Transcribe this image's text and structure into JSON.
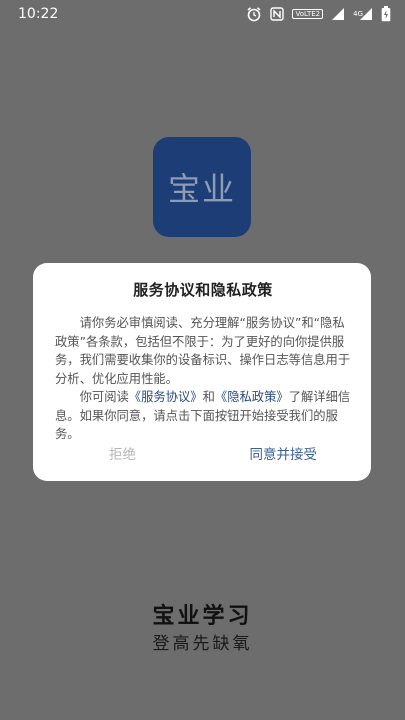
{
  "status_bar": {
    "time": "10:22",
    "volte": "VoLTE2",
    "network_label": "4G",
    "icons": [
      "alarm-icon",
      "nfc-icon",
      "volte-icon",
      "signal-icon",
      "battery-icon"
    ]
  },
  "app_icon": {
    "text": "宝业"
  },
  "dialog": {
    "title": "服务协议和隐私政策",
    "para1": "请你务必审慎阅读、充分理解“服务协议”和“隐私政策”各条款，包括但不限于：为了更好的向你提供服务，我们需要收集你的设备标识、操作日志等信息用于分析、优化应用性能。",
    "para2_prefix": "你可阅读",
    "link_service": "《服务协议》",
    "para2_and": "和",
    "link_privacy": "《隐私政策》",
    "para2_suffix": "了解详细信息。如果你同意，请点击下面按钮开始接受我们的服务。",
    "reject_label": "拒绝",
    "accept_label": "同意并接受"
  },
  "brand": {
    "name": "宝业学习",
    "slogan": "登高先缺氧"
  },
  "colors": {
    "background": "#6d6d6d",
    "app_icon_bg": "#1c3d75",
    "accent": "#3b5f95",
    "disabled": "#b6b6b6"
  }
}
